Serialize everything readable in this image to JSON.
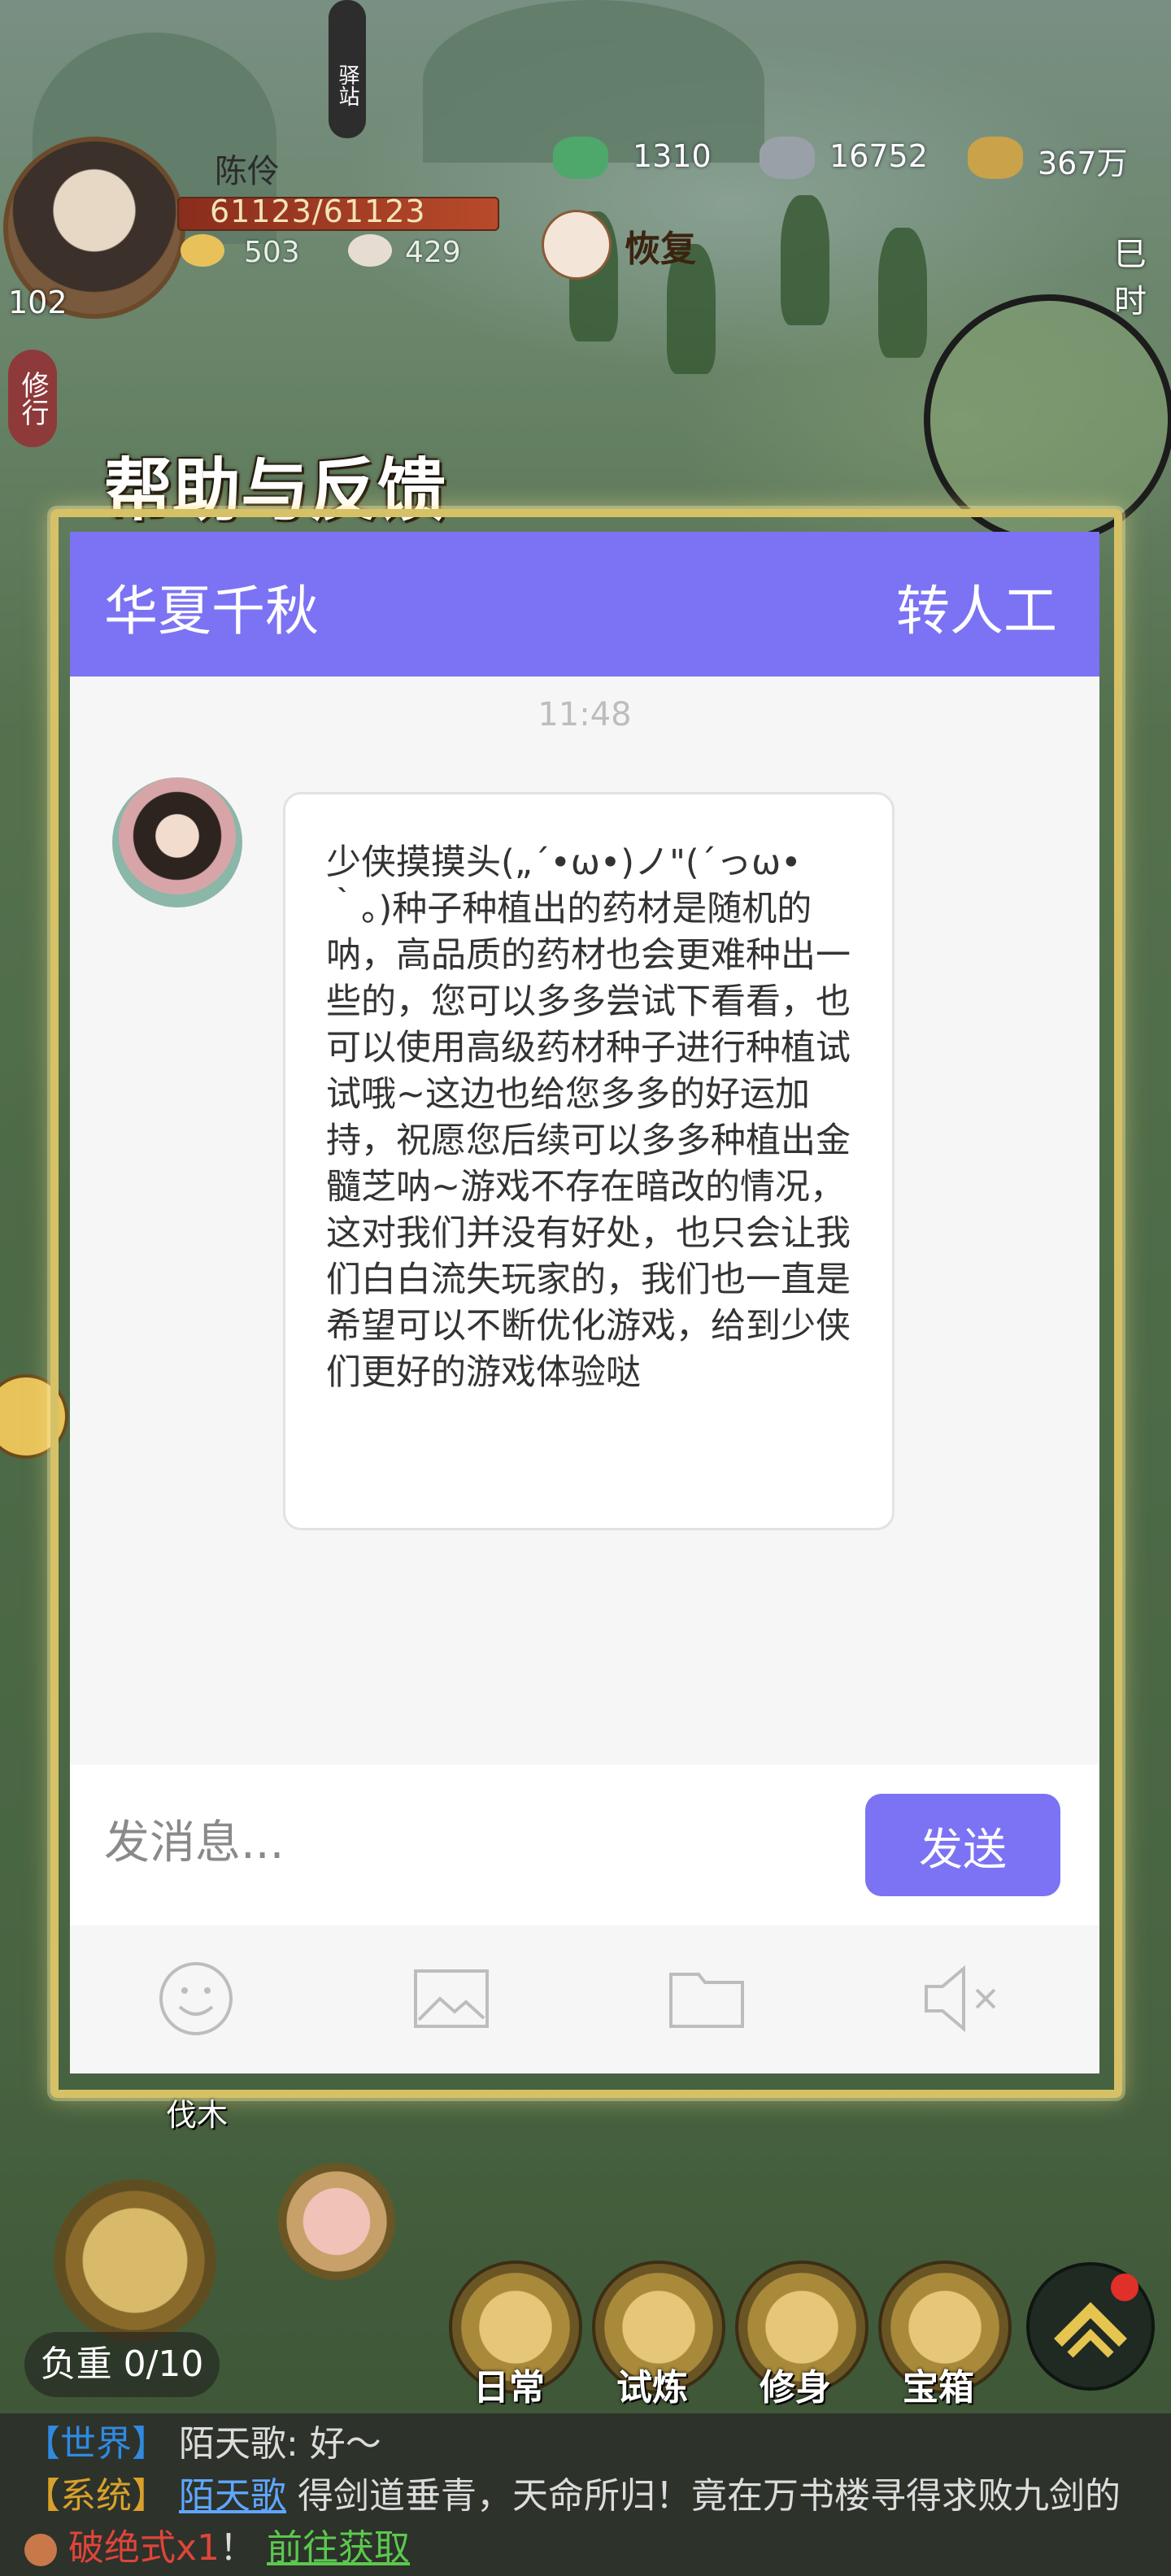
{
  "hud": {
    "vertical_tag": "驿站",
    "player_name": "陈伶",
    "level": "102",
    "hp": "61123/61123",
    "res1": "503",
    "res2": "429",
    "currency1": "1310",
    "currency2": "16752",
    "currency3": "367万",
    "restore": "恢复",
    "right_top": "巳时",
    "left_pill": "修行",
    "tree_label": "伐木"
  },
  "dialog": {
    "title": "帮助与反馈",
    "header_title": "华夏千秋",
    "header_action": "转人工",
    "timestamp": "11:48",
    "message": "少侠摸摸头(„´•ω•)ノ\"(´っω•｀。)种子种植出的药材是随机的呐，高品质的药材也会更难种出一些的，您可以多多尝试下看看，也可以使用高级药材种子进行种植试试哦~这边也给您多多的好运加持，祝愿您后续可以多多种植出金髓芝呐~游戏不存在暗改的情况，这对我们并没有好处，也只会让我们白白流失玩家的，我们也一直是希望可以不断优化游戏，给到少侠们更好的游戏体验哒",
    "input_placeholder": "发消息...",
    "send_label": "发送",
    "tools": [
      "emoji-icon",
      "image-icon",
      "folder-icon",
      "mute-icon"
    ]
  },
  "bottom": {
    "load": "负重 0/10",
    "buttons": [
      "日常",
      "试炼",
      "修身",
      "宝箱"
    ]
  },
  "chat": {
    "line1_channel": "【世界】",
    "line1_text": "陌天歌: 好～",
    "line2_channel": "【系统】",
    "line2_link": "陌天歌",
    "line2_text": "得剑道垂青，天命所归！竟在万书楼寻得求败九剑的",
    "line3_item": "破绝式x1",
    "line3_mark": "！",
    "line3_link": "前往获取"
  },
  "colors": {
    "accent": "#7b73f3",
    "frame_gold": "#d6c167"
  }
}
